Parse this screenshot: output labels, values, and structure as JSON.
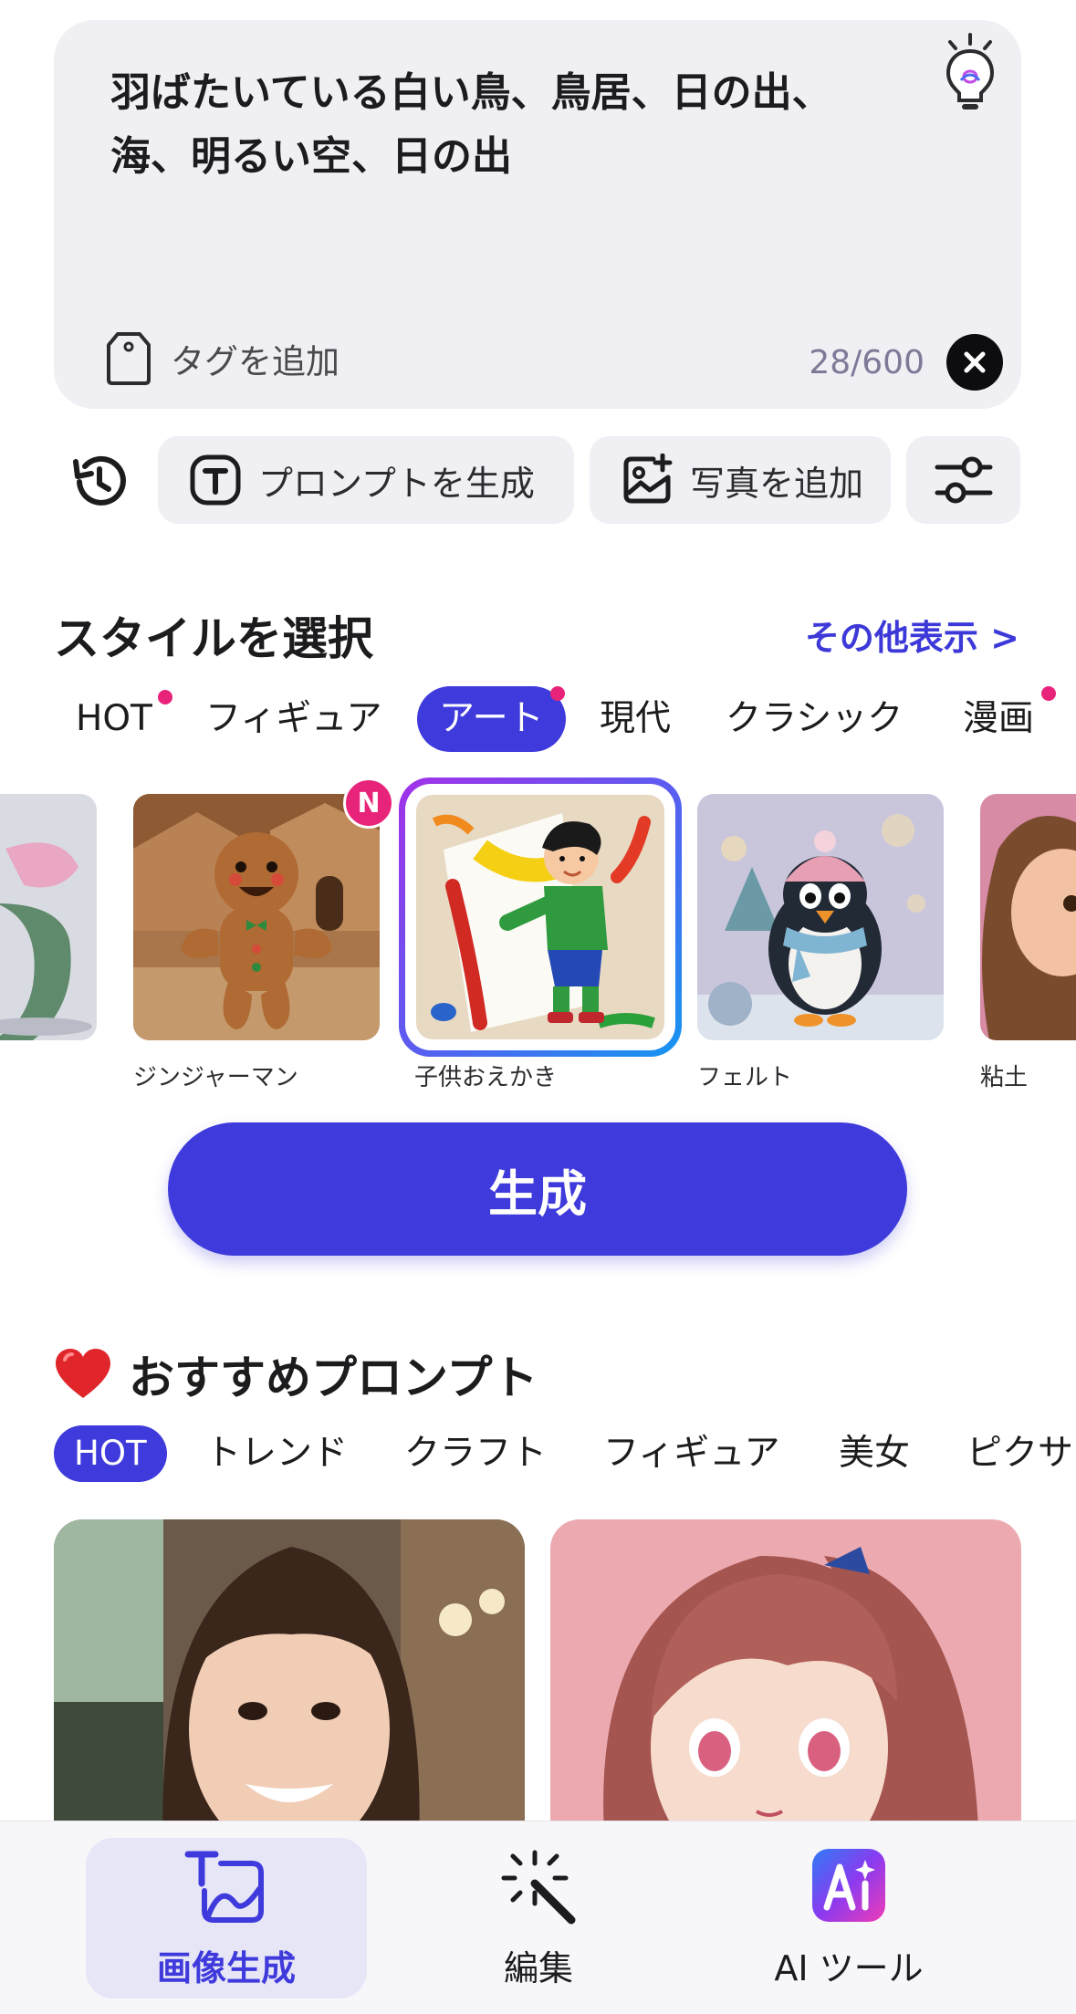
{
  "prompt": {
    "text": "羽ばたいている白い鳥、鳥居、日の出、海、明るい空、日の出",
    "tag_label": "タグを追加",
    "counter": "28/600"
  },
  "toolbar": {
    "generate_prompt_label": "プロンプトを生成",
    "add_photo_label": "写真を追加"
  },
  "style_section": {
    "title": "スタイルを選択",
    "more_label": "その他表示 >",
    "tabs": [
      {
        "label": "HOT",
        "dot": true
      },
      {
        "label": "フィギュア",
        "dot": false
      },
      {
        "label": "アート",
        "dot": true,
        "active": true
      },
      {
        "label": "現代",
        "dot": false
      },
      {
        "label": "クラシック",
        "dot": false
      },
      {
        "label": "漫画",
        "dot": true
      }
    ],
    "styles": [
      {
        "caption": "ジンジャーマン",
        "badge": "N"
      },
      {
        "caption": "子供おえかき",
        "selected": true
      },
      {
        "caption": "フェルト"
      },
      {
        "caption": "粘土"
      }
    ]
  },
  "generate_button": "生成",
  "recommended": {
    "title": "おすすめプロンプト",
    "tabs": [
      {
        "label": "HOT",
        "active": true
      },
      {
        "label": "トレンド"
      },
      {
        "label": "クラフト"
      },
      {
        "label": "フィギュア"
      },
      {
        "label": "美女"
      },
      {
        "label": "ピクサ"
      }
    ]
  },
  "bottom_nav": [
    {
      "label": "画像生成",
      "icon": "text-image-icon",
      "active": true
    },
    {
      "label": "編集",
      "icon": "magic-wand-icon"
    },
    {
      "label": "AI ツール",
      "icon": "ai-tools-icon"
    }
  ],
  "colors": {
    "accent": "#3f3adb",
    "badge": "#e8247a",
    "box_bg": "#efeff4"
  }
}
